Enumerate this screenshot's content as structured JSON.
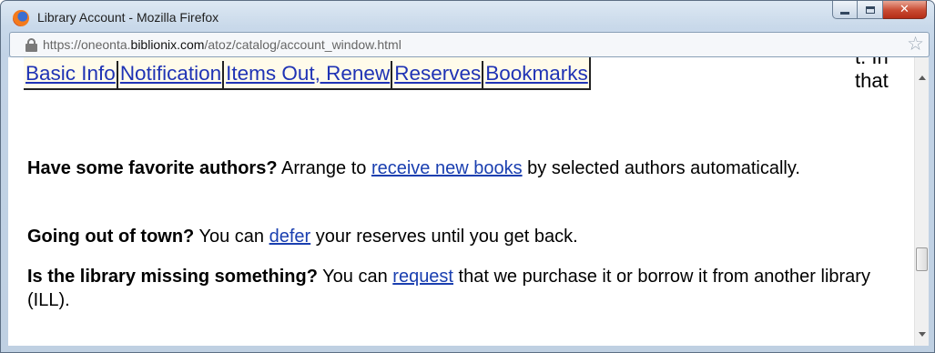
{
  "window": {
    "title": "Library Account - Mozilla Firefox"
  },
  "urlbar": {
    "prefix": "https://oneonta.",
    "domain": "biblionix.com",
    "path": "/atoz/catalog/account_window.html"
  },
  "tabs": [
    {
      "label": "Basic Info"
    },
    {
      "label": "Notification"
    },
    {
      "label": "Items Out, Renew"
    },
    {
      "label": "Reserves"
    },
    {
      "label": "Bookmarks"
    }
  ],
  "peek_text": "t. In that",
  "paragraphs": [
    {
      "bold": "Have some favorite authors?",
      "before": " Arrange to ",
      "link": "receive new books",
      "after": " by selected authors automatically."
    },
    {
      "bold": "Going out of town?",
      "before": " You can ",
      "link": "defer",
      "after": " your reserves until you get back."
    },
    {
      "bold": "Is the library missing something?",
      "before": " You can ",
      "link": "request",
      "after": " that we purchase it or borrow it from another library (ILL)."
    }
  ],
  "icons": {
    "app": "firefox-icon",
    "lock": "lock-icon",
    "bookmark": "star-icon",
    "minimize": "minimize-icon",
    "maximize": "maximize-icon",
    "close": "close-icon"
  },
  "colors": {
    "link": "#1a3fb0",
    "tab_bar_bg": "#fffbea",
    "close_button": "#c84a31"
  }
}
